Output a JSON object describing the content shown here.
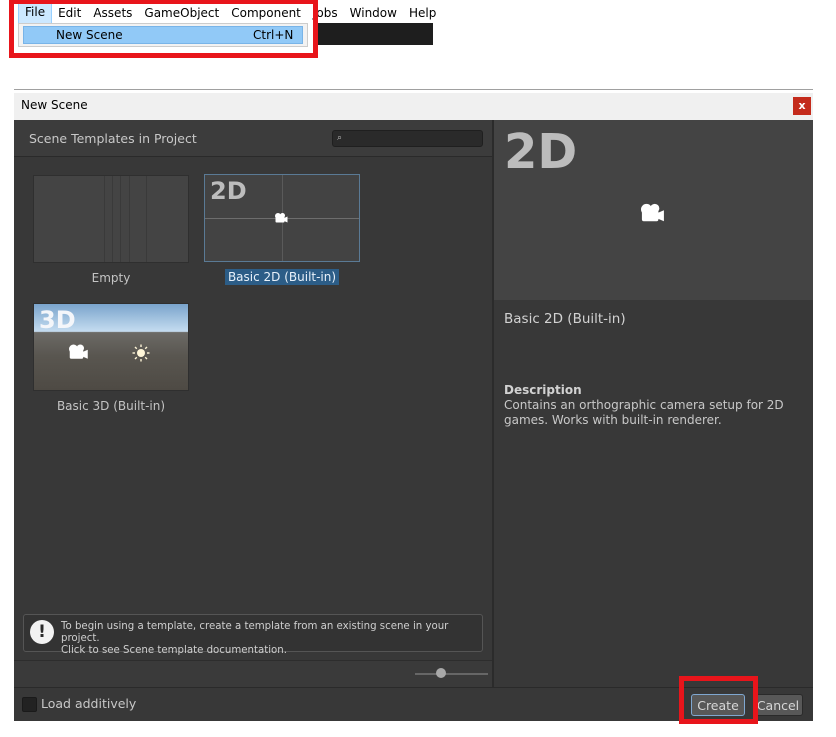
{
  "menubar": {
    "items": [
      "File",
      "Edit",
      "Assets",
      "GameObject",
      "Component",
      "Jobs",
      "Window",
      "Help"
    ]
  },
  "file_menu": {
    "item_label": "New Scene",
    "item_shortcut": "Ctrl+N"
  },
  "window": {
    "title": "New Scene",
    "close_glyph": "x"
  },
  "left_panel": {
    "header": "Scene Templates in Project",
    "search_placeholder": "",
    "search_icon_glyph": "🔍"
  },
  "templates": [
    {
      "label": "Empty",
      "thumb_text": ""
    },
    {
      "label": "Basic 2D (Built-in)",
      "thumb_text": "2D",
      "selected": true
    },
    {
      "label": "Basic 3D (Built-in)",
      "thumb_text": "3D"
    }
  ],
  "info_bar": {
    "icon_glyph": "!",
    "line1": "To begin using a template, create a template from an existing scene in your project.",
    "line2": "Click to see Scene template documentation."
  },
  "zoom_slider": {
    "value_fraction": 0.36
  },
  "details": {
    "preview_text": "2D",
    "title": "Basic 2D (Built-in)",
    "description_heading": "Description",
    "description": "Contains an orthographic camera setup for 2D games. Works with built-in renderer."
  },
  "footer": {
    "load_additively_label": "Load additively",
    "load_additively_checked": false,
    "create_label": "Create",
    "cancel_label": "Cancel"
  },
  "icons": {
    "camera": "camera-icon",
    "light": "sun-icon"
  },
  "colors": {
    "highlight_red": "#e8151b",
    "selection_blue": "#2c5d87",
    "menu_hover": "#91c9f7"
  }
}
